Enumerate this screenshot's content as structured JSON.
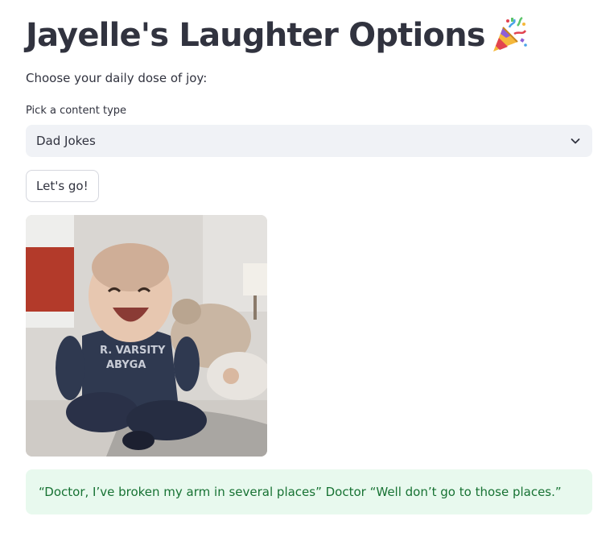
{
  "header": {
    "title": "Jayelle's Laughter Options",
    "title_icon": "party-popper-icon"
  },
  "intro": {
    "text": "Choose your daily dose of joy:"
  },
  "content_select": {
    "label": "Pick a content type",
    "selected": "Dad Jokes",
    "icon": "chevron-down-icon"
  },
  "go_button": {
    "label": "Let's go!"
  },
  "media": {
    "description": "laughing-baby-gif",
    "shirt_text_line1": "R. VARSITY",
    "shirt_text_line2": "ABYGA"
  },
  "result": {
    "text": "“Doctor, I’ve broken my arm in several places” Doctor “Well don’t go to those places.”",
    "color": "#177233",
    "background": "#e8f9ee"
  }
}
